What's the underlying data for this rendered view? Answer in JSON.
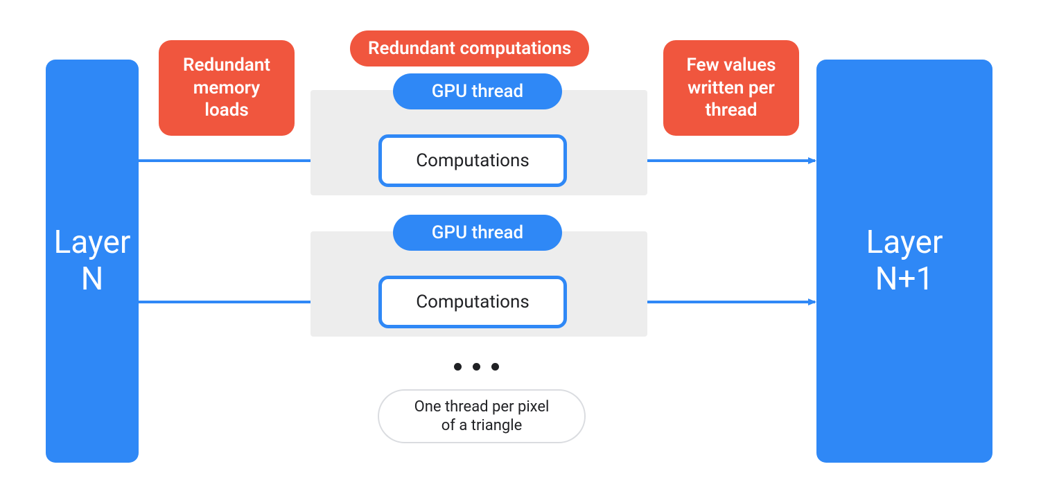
{
  "colors": {
    "blue": "#2F88F6",
    "red": "#F0563E",
    "grey_bg": "#EDEDED",
    "text_dark": "#202124",
    "outline_grey": "#DADCE0"
  },
  "layers": {
    "left": "Layer\nN",
    "right": "Layer\nN+1"
  },
  "callouts": {
    "redundant_memory": "Redundant\nmemory\nloads",
    "redundant_computations": "Redundant computations",
    "few_values": "Few values\nwritten per\nthread"
  },
  "threads": [
    {
      "pill": "GPU thread",
      "box": "Computations"
    },
    {
      "pill": "GPU thread",
      "box": "Computations"
    }
  ],
  "ellipsis": "● ● ●",
  "footer_pill": "One thread per pixel\nof a triangle"
}
